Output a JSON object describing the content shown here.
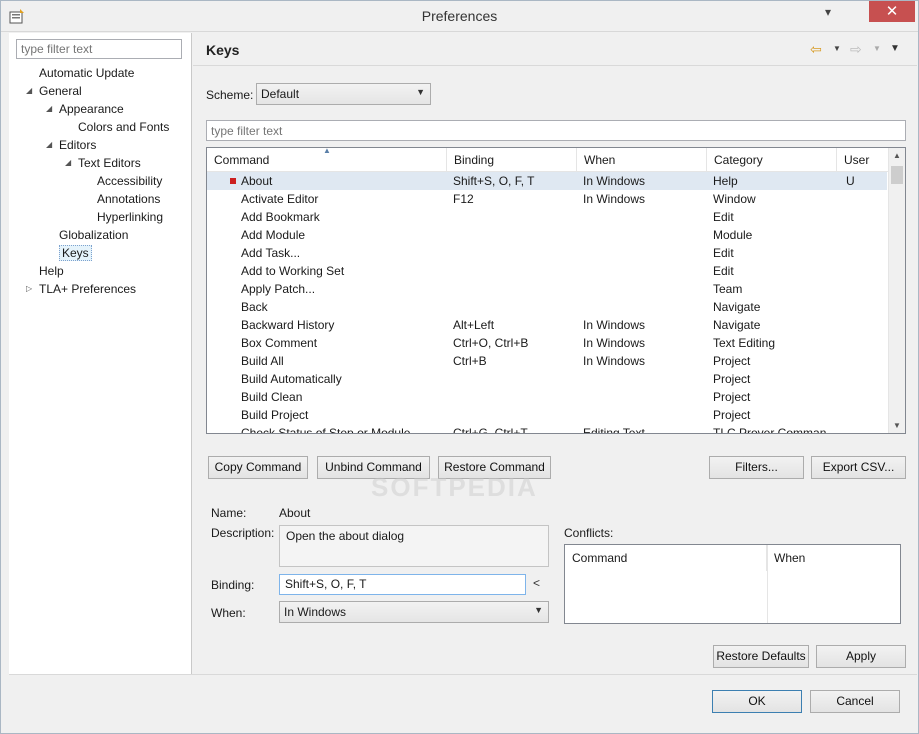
{
  "window": {
    "title": "Preferences",
    "minimize": "▾",
    "close": "✕"
  },
  "sidebar": {
    "filter_placeholder": "type filter text",
    "items": [
      {
        "label": "Automatic Update",
        "level": 1,
        "expanded": null
      },
      {
        "label": "General",
        "level": 1,
        "expanded": true
      },
      {
        "label": "Appearance",
        "level": 2,
        "expanded": true
      },
      {
        "label": "Colors and Fonts",
        "level": 3,
        "expanded": null
      },
      {
        "label": "Editors",
        "level": 2,
        "expanded": true
      },
      {
        "label": "Text Editors",
        "level": 3,
        "expanded": true
      },
      {
        "label": "Accessibility",
        "level": 4,
        "expanded": null
      },
      {
        "label": "Annotations",
        "level": 4,
        "expanded": null
      },
      {
        "label": "Hyperlinking",
        "level": 4,
        "expanded": null
      },
      {
        "label": "Globalization",
        "level": 2,
        "expanded": null
      },
      {
        "label": "Keys",
        "level": 2,
        "expanded": null,
        "selected": true
      },
      {
        "label": "Help",
        "level": 1,
        "expanded": null
      },
      {
        "label": "TLA+ Preferences",
        "level": 1,
        "expanded": false
      }
    ]
  },
  "page": {
    "title": "Keys"
  },
  "scheme": {
    "label": "Scheme:",
    "value": "Default"
  },
  "keys_filter": {
    "placeholder": "type filter text"
  },
  "table": {
    "columns": [
      "Command",
      "Binding",
      "When",
      "Category",
      "User"
    ],
    "rows": [
      {
        "command": "About",
        "binding": "Shift+S, O, F, T",
        "when": "In Windows",
        "category": "Help",
        "user": "U",
        "selected": true
      },
      {
        "command": "Activate Editor",
        "binding": "F12",
        "when": "In Windows",
        "category": "Window",
        "user": ""
      },
      {
        "command": "Add Bookmark",
        "binding": "",
        "when": "",
        "category": "Edit",
        "user": ""
      },
      {
        "command": "Add Module",
        "binding": "",
        "when": "",
        "category": "Module",
        "user": ""
      },
      {
        "command": "Add Task...",
        "binding": "",
        "when": "",
        "category": "Edit",
        "user": ""
      },
      {
        "command": "Add to Working Set",
        "binding": "",
        "when": "",
        "category": "Edit",
        "user": ""
      },
      {
        "command": "Apply Patch...",
        "binding": "",
        "when": "",
        "category": "Team",
        "user": ""
      },
      {
        "command": "Back",
        "binding": "",
        "when": "",
        "category": "Navigate",
        "user": ""
      },
      {
        "command": "Backward History",
        "binding": "Alt+Left",
        "when": "In Windows",
        "category": "Navigate",
        "user": ""
      },
      {
        "command": "Box Comment",
        "binding": "Ctrl+O, Ctrl+B",
        "when": "In Windows",
        "category": "Text Editing",
        "user": ""
      },
      {
        "command": "Build All",
        "binding": "Ctrl+B",
        "when": "In Windows",
        "category": "Project",
        "user": ""
      },
      {
        "command": "Build Automatically",
        "binding": "",
        "when": "",
        "category": "Project",
        "user": ""
      },
      {
        "command": "Build Clean",
        "binding": "",
        "when": "",
        "category": "Project",
        "user": ""
      },
      {
        "command": "Build Project",
        "binding": "",
        "when": "",
        "category": "Project",
        "user": ""
      },
      {
        "command": "Check Status of Step or Module",
        "binding": "Ctrl+G, Ctrl+T",
        "when": "Editing Text",
        "category": "TLC Prover Comman",
        "user": ""
      }
    ]
  },
  "buttons": {
    "copy": "Copy Command",
    "unbind": "Unbind Command",
    "restore_command": "Restore Command",
    "filters": "Filters...",
    "export": "Export CSV...",
    "restore_defaults": "Restore Defaults",
    "apply": "Apply",
    "ok": "OK",
    "cancel": "Cancel"
  },
  "details": {
    "name_label": "Name:",
    "name_value": "About",
    "description_label": "Description:",
    "description_value": "Open the about dialog",
    "binding_label": "Binding:",
    "binding_value": "Shift+S, O, F, T",
    "binding_button": "<",
    "when_label": "When:",
    "when_value": "In Windows"
  },
  "conflicts": {
    "label": "Conflicts:",
    "columns": [
      "Command",
      "When"
    ]
  },
  "watermark": "SOFTPEDIA"
}
